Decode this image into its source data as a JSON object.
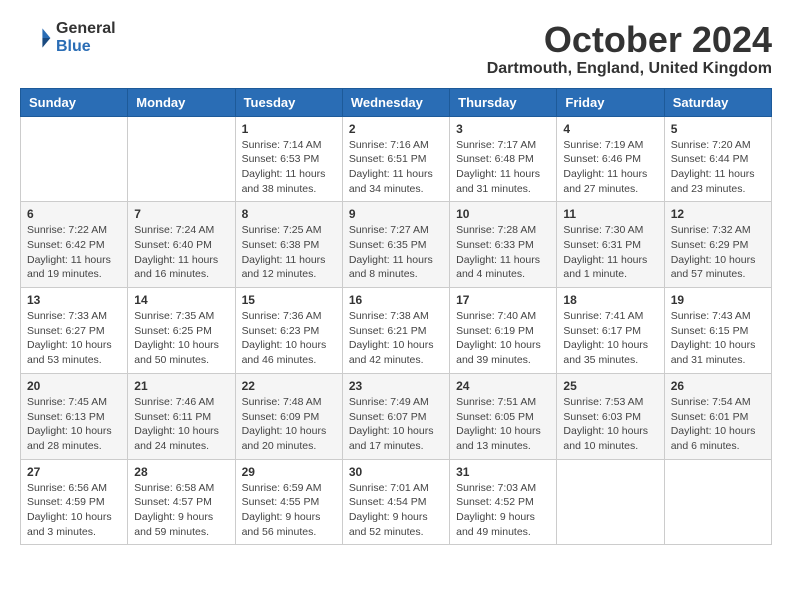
{
  "logo": {
    "general": "General",
    "blue": "Blue"
  },
  "title": "October 2024",
  "location": "Dartmouth, England, United Kingdom",
  "days_of_week": [
    "Sunday",
    "Monday",
    "Tuesday",
    "Wednesday",
    "Thursday",
    "Friday",
    "Saturday"
  ],
  "weeks": [
    [
      {
        "day": "",
        "info": ""
      },
      {
        "day": "",
        "info": ""
      },
      {
        "day": "1",
        "info": "Sunrise: 7:14 AM\nSunset: 6:53 PM\nDaylight: 11 hours and 38 minutes."
      },
      {
        "day": "2",
        "info": "Sunrise: 7:16 AM\nSunset: 6:51 PM\nDaylight: 11 hours and 34 minutes."
      },
      {
        "day": "3",
        "info": "Sunrise: 7:17 AM\nSunset: 6:48 PM\nDaylight: 11 hours and 31 minutes."
      },
      {
        "day": "4",
        "info": "Sunrise: 7:19 AM\nSunset: 6:46 PM\nDaylight: 11 hours and 27 minutes."
      },
      {
        "day": "5",
        "info": "Sunrise: 7:20 AM\nSunset: 6:44 PM\nDaylight: 11 hours and 23 minutes."
      }
    ],
    [
      {
        "day": "6",
        "info": "Sunrise: 7:22 AM\nSunset: 6:42 PM\nDaylight: 11 hours and 19 minutes."
      },
      {
        "day": "7",
        "info": "Sunrise: 7:24 AM\nSunset: 6:40 PM\nDaylight: 11 hours and 16 minutes."
      },
      {
        "day": "8",
        "info": "Sunrise: 7:25 AM\nSunset: 6:38 PM\nDaylight: 11 hours and 12 minutes."
      },
      {
        "day": "9",
        "info": "Sunrise: 7:27 AM\nSunset: 6:35 PM\nDaylight: 11 hours and 8 minutes."
      },
      {
        "day": "10",
        "info": "Sunrise: 7:28 AM\nSunset: 6:33 PM\nDaylight: 11 hours and 4 minutes."
      },
      {
        "day": "11",
        "info": "Sunrise: 7:30 AM\nSunset: 6:31 PM\nDaylight: 11 hours and 1 minute."
      },
      {
        "day": "12",
        "info": "Sunrise: 7:32 AM\nSunset: 6:29 PM\nDaylight: 10 hours and 57 minutes."
      }
    ],
    [
      {
        "day": "13",
        "info": "Sunrise: 7:33 AM\nSunset: 6:27 PM\nDaylight: 10 hours and 53 minutes."
      },
      {
        "day": "14",
        "info": "Sunrise: 7:35 AM\nSunset: 6:25 PM\nDaylight: 10 hours and 50 minutes."
      },
      {
        "day": "15",
        "info": "Sunrise: 7:36 AM\nSunset: 6:23 PM\nDaylight: 10 hours and 46 minutes."
      },
      {
        "day": "16",
        "info": "Sunrise: 7:38 AM\nSunset: 6:21 PM\nDaylight: 10 hours and 42 minutes."
      },
      {
        "day": "17",
        "info": "Sunrise: 7:40 AM\nSunset: 6:19 PM\nDaylight: 10 hours and 39 minutes."
      },
      {
        "day": "18",
        "info": "Sunrise: 7:41 AM\nSunset: 6:17 PM\nDaylight: 10 hours and 35 minutes."
      },
      {
        "day": "19",
        "info": "Sunrise: 7:43 AM\nSunset: 6:15 PM\nDaylight: 10 hours and 31 minutes."
      }
    ],
    [
      {
        "day": "20",
        "info": "Sunrise: 7:45 AM\nSunset: 6:13 PM\nDaylight: 10 hours and 28 minutes."
      },
      {
        "day": "21",
        "info": "Sunrise: 7:46 AM\nSunset: 6:11 PM\nDaylight: 10 hours and 24 minutes."
      },
      {
        "day": "22",
        "info": "Sunrise: 7:48 AM\nSunset: 6:09 PM\nDaylight: 10 hours and 20 minutes."
      },
      {
        "day": "23",
        "info": "Sunrise: 7:49 AM\nSunset: 6:07 PM\nDaylight: 10 hours and 17 minutes."
      },
      {
        "day": "24",
        "info": "Sunrise: 7:51 AM\nSunset: 6:05 PM\nDaylight: 10 hours and 13 minutes."
      },
      {
        "day": "25",
        "info": "Sunrise: 7:53 AM\nSunset: 6:03 PM\nDaylight: 10 hours and 10 minutes."
      },
      {
        "day": "26",
        "info": "Sunrise: 7:54 AM\nSunset: 6:01 PM\nDaylight: 10 hours and 6 minutes."
      }
    ],
    [
      {
        "day": "27",
        "info": "Sunrise: 6:56 AM\nSunset: 4:59 PM\nDaylight: 10 hours and 3 minutes."
      },
      {
        "day": "28",
        "info": "Sunrise: 6:58 AM\nSunset: 4:57 PM\nDaylight: 9 hours and 59 minutes."
      },
      {
        "day": "29",
        "info": "Sunrise: 6:59 AM\nSunset: 4:55 PM\nDaylight: 9 hours and 56 minutes."
      },
      {
        "day": "30",
        "info": "Sunrise: 7:01 AM\nSunset: 4:54 PM\nDaylight: 9 hours and 52 minutes."
      },
      {
        "day": "31",
        "info": "Sunrise: 7:03 AM\nSunset: 4:52 PM\nDaylight: 9 hours and 49 minutes."
      },
      {
        "day": "",
        "info": ""
      },
      {
        "day": "",
        "info": ""
      }
    ]
  ]
}
